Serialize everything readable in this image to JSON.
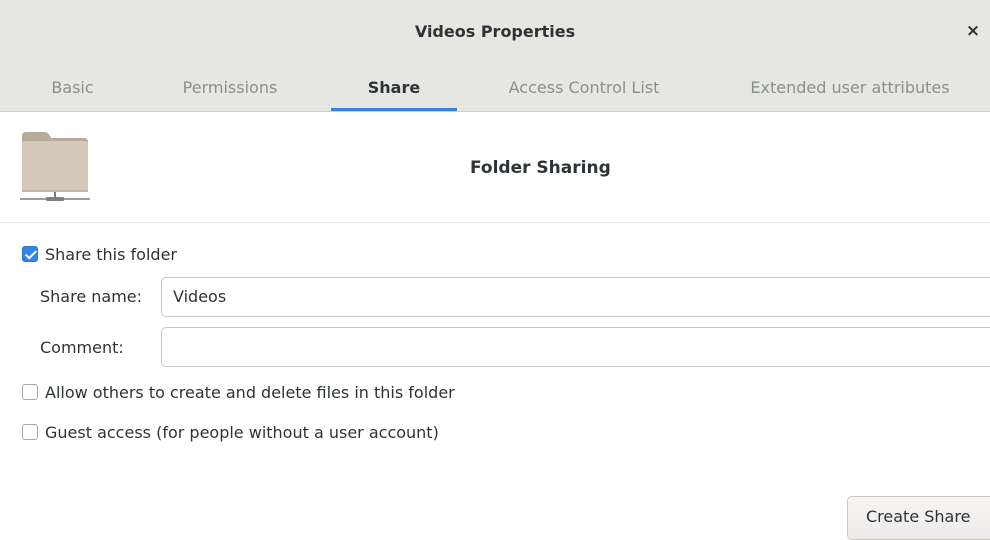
{
  "window": {
    "title": "Videos Properties",
    "close_glyph": "×"
  },
  "tabs": [
    {
      "label": "Basic",
      "active": false
    },
    {
      "label": "Permissions",
      "active": false
    },
    {
      "label": "Share",
      "active": true
    },
    {
      "label": "Access Control List",
      "active": false
    },
    {
      "label": "Extended user attributes",
      "active": false
    }
  ],
  "header": {
    "icon": "folder-share-icon",
    "title": "Folder Sharing"
  },
  "share_checkbox": {
    "label": "Share this folder",
    "checked": true
  },
  "fields": {
    "share_name": {
      "label": "Share name:",
      "value": "Videos"
    },
    "comment": {
      "label": "Comment:",
      "value": ""
    }
  },
  "options": {
    "allow_write": {
      "label": "Allow others to create and delete files in this folder",
      "checked": false
    },
    "guest_access": {
      "label": "Guest access (for people without a user account)",
      "checked": false
    }
  },
  "actions": {
    "create_label": "Create Share"
  },
  "colors": {
    "accent": "#3584e4",
    "folder": "#c9bcad"
  }
}
